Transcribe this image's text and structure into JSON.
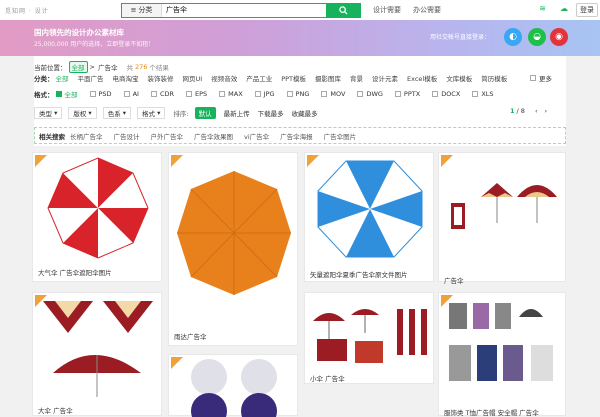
{
  "header": {
    "logo": "觅知网 · 设计",
    "category": "分类",
    "query": "广告伞",
    "links": [
      "设计需要",
      "办公需要"
    ],
    "login": "登录"
  },
  "banner": {
    "title": "国内领先的设计办公素材库",
    "subtitle": "25,000,000 用户的选择，立即登录不如租！",
    "right": "用社交帐号直接登录："
  },
  "location": {
    "label": "当前位置：",
    "all": "全部",
    "sep": ">",
    "kw": "广告伞",
    "count_pre": "共",
    "count": "276",
    "count_suf": "个结果"
  },
  "categories": {
    "label": "分类：",
    "items": [
      "全部",
      "平面广告",
      "电商淘宝",
      "装饰装修",
      "网页UI",
      "视频音效",
      "产品工业",
      "PPT模板",
      "摄影图库",
      "背景",
      "设计元素",
      "Excel模板",
      "文库模板",
      "简历模板"
    ],
    "more": "更多"
  },
  "formats": {
    "label": "格式：",
    "items": [
      "全部",
      "PSD",
      "AI",
      "CDR",
      "EPS",
      "MAX",
      "JPG",
      "PNG",
      "MOV",
      "DWG",
      "PPTX",
      "DOCX",
      "XLS"
    ]
  },
  "filters": {
    "dropdowns": [
      "类型",
      "版权",
      "色系",
      "格式"
    ],
    "sort_label": "排序:",
    "sorts": [
      "默认",
      "最新上传",
      "下载最多",
      "收藏最多"
    ],
    "page": "1",
    "pages": "/ 8"
  },
  "related": {
    "label": "相关搜索",
    "items": [
      "长柄广告伞",
      "广告设计",
      "户外广告伞",
      "广告伞效果图",
      "vi广告伞",
      "广告伞海报",
      "广告伞图片"
    ]
  },
  "cards": [
    {
      "caption": "大气伞 广告伞遮阳伞图片"
    },
    {
      "caption": "雨达广告伞"
    },
    {
      "caption": "矢量遮阳伞夏季广告伞原文件图片"
    },
    {
      "caption": "广告伞"
    },
    {
      "caption": "大伞 广告伞"
    },
    {
      "caption": ""
    },
    {
      "caption": "小伞 广告伞"
    },
    {
      "caption": "服饰类 T恤广告帽 安全帽 广告伞"
    }
  ],
  "colors": {
    "accent": "#17b35c",
    "red": "#d9232a",
    "orange": "#e8811c",
    "blue": "#2f8fdc",
    "maroon": "#9b1c23"
  }
}
